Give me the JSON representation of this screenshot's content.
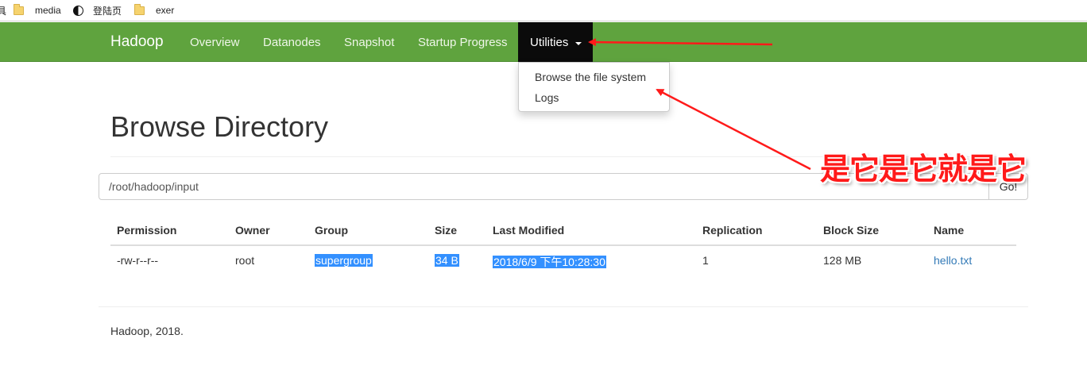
{
  "bookmarks": {
    "cutoff_label": "具",
    "items": [
      {
        "label": "media",
        "icon": "folder-icon"
      },
      {
        "label": "登陆页",
        "icon": "yinyang-icon"
      },
      {
        "label": "exer",
        "icon": "folder-icon"
      }
    ]
  },
  "navbar": {
    "brand": "Hadoop",
    "color": "#5fa33e",
    "items": [
      "Overview",
      "Datanodes",
      "Snapshot",
      "Startup Progress"
    ],
    "active": "Utilities"
  },
  "dropdown": {
    "items": [
      "Browse the file system",
      "Logs"
    ]
  },
  "page": {
    "title": "Browse Directory"
  },
  "path": {
    "value": "/root/hadoop/input",
    "go_label": "Go!"
  },
  "table": {
    "headers": [
      "Permission",
      "Owner",
      "Group",
      "Size",
      "Last Modified",
      "Replication",
      "Block Size",
      "Name"
    ],
    "rows": [
      {
        "permission": "-rw-r--r--",
        "owner": "root",
        "group": "supergroup",
        "size": "34 B",
        "last_modified": "2018/6/9 下午10:28:30",
        "replication": "1",
        "block_size": "128 MB",
        "name": "hello.txt"
      }
    ]
  },
  "footer": {
    "text": "Hadoop, 2018."
  },
  "annotation": {
    "text": "是它是它就是它",
    "color": "#ff1a1a"
  }
}
